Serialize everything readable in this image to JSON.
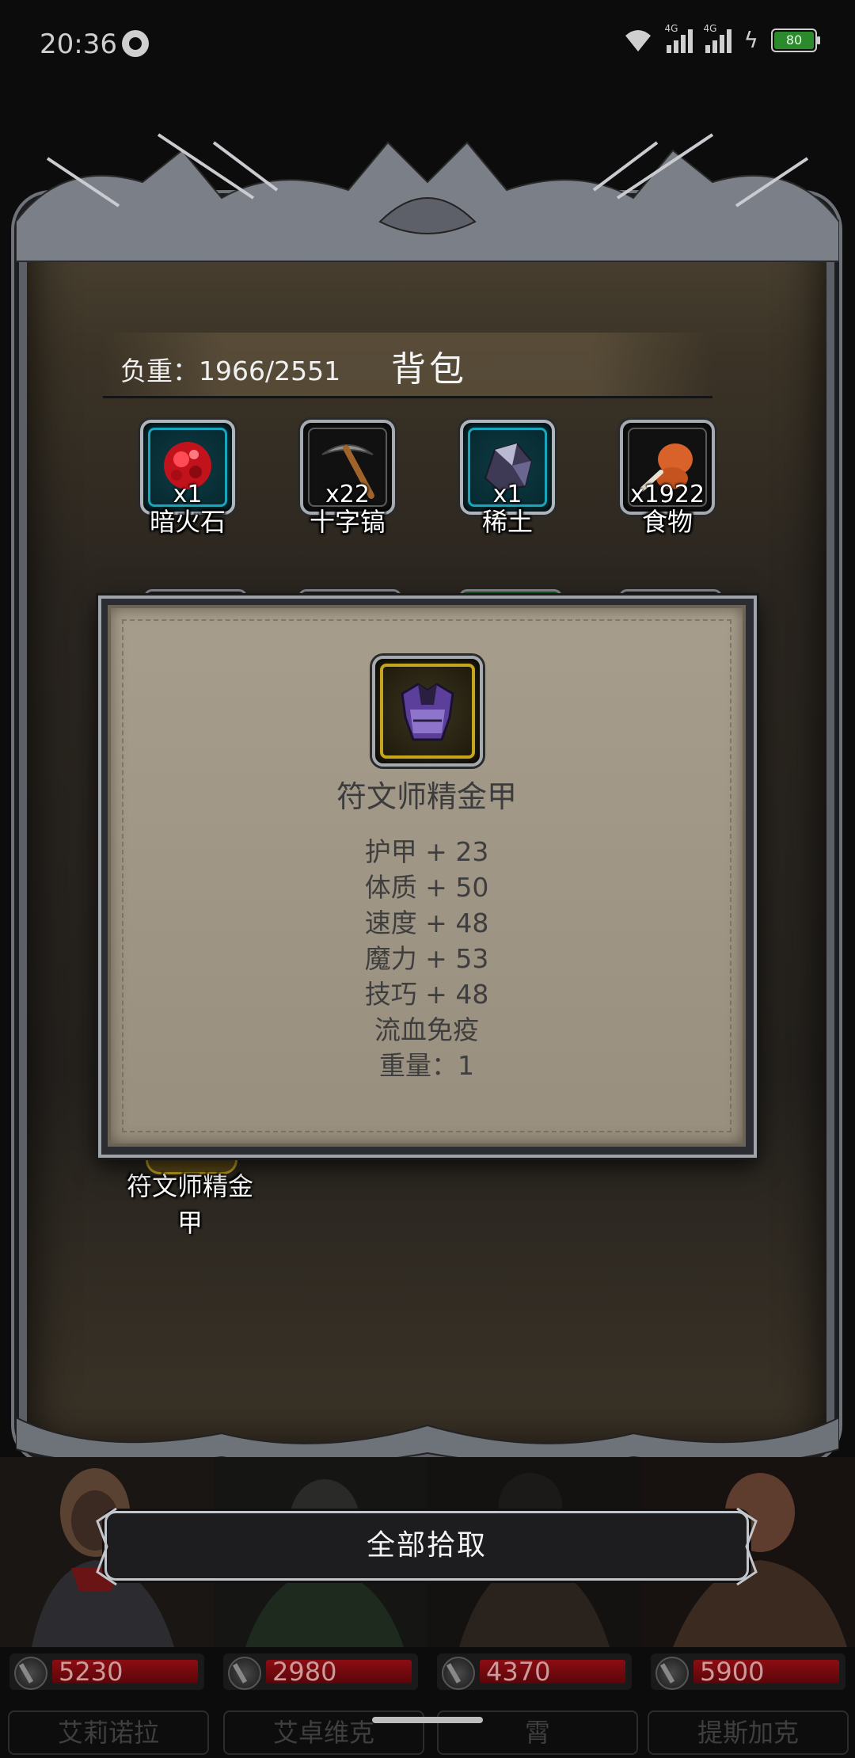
{
  "status_bar": {
    "time": "20:36",
    "network_1": "4G",
    "network_2": "4G",
    "battery": "80"
  },
  "backpack": {
    "weight_label": "负重：1966/2551",
    "title": "背包",
    "items": [
      {
        "name": "暗火石",
        "count": "x1",
        "icon": "dark-fire-stone-icon",
        "frame": "teal"
      },
      {
        "name": "十字镐",
        "count": "x22",
        "icon": "pickaxe-icon",
        "frame": "dark"
      },
      {
        "name": "稀土",
        "count": "x1",
        "icon": "rare-earth-icon",
        "frame": "teal"
      },
      {
        "name": "食物",
        "count": "x1922",
        "icon": "food-drumstick-icon",
        "frame": "dark"
      }
    ],
    "partially_hidden_item_name": "符文师精金甲"
  },
  "tooltip": {
    "item_name": "符文师精金甲",
    "icon": "rune-armor-icon",
    "stats": [
      "护甲 + 23",
      "体质 + 50",
      "速度 + 48",
      "魔力 + 53",
      "技巧 + 48",
      "流血免疫",
      "重量：1"
    ]
  },
  "pick_all_button": "全部拾取",
  "heroes": [
    {
      "name": "艾莉诺拉",
      "hp": "5230"
    },
    {
      "name": "艾卓维克",
      "hp": "2980"
    },
    {
      "name": "霄",
      "hp": "4370"
    },
    {
      "name": "提斯加克",
      "hp": "5900"
    }
  ],
  "colors": {
    "panel_bg": "#2b2620",
    "tooltip_bg": "#a79d8d",
    "teal_frame": "#19a6bc",
    "gold_frame": "#c6a51e",
    "hp_red": "#8c0d12"
  }
}
